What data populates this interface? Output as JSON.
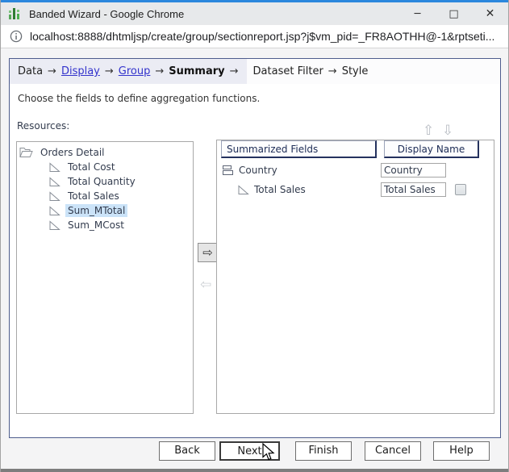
{
  "window": {
    "title": "Banded Wizard - Google Chrome",
    "icons": {
      "minimize": "─",
      "maximize": "□",
      "close": "✕"
    }
  },
  "address_bar": {
    "url": "localhost:8888/dhtmljsp/create/group/sectionreport.jsp?j$vm_pid=_FR8AOTHH@-1&rptseti..."
  },
  "breadcrumb": {
    "arrow": "→",
    "steps": [
      {
        "label": "Data",
        "type": "plain"
      },
      {
        "label": "Display",
        "type": "link"
      },
      {
        "label": "Group",
        "type": "link"
      },
      {
        "label": "Summary",
        "type": "current"
      },
      {
        "label": "Dataset Filter",
        "type": "future"
      },
      {
        "label": "Style",
        "type": "future"
      }
    ]
  },
  "instruction": "Choose the fields to define aggregation functions.",
  "resources_label": "Resources:",
  "tree": {
    "root": "Orders Detail",
    "items": [
      {
        "label": "Total Cost",
        "selected": false
      },
      {
        "label": "Total Quantity",
        "selected": false
      },
      {
        "label": "Total Sales",
        "selected": false
      },
      {
        "label": "Sum_MTotal",
        "selected": true
      },
      {
        "label": "Sum_MCost",
        "selected": false
      }
    ]
  },
  "summary_table": {
    "headers": [
      "Summarized Fields",
      "Display Name"
    ],
    "rows": [
      {
        "field": "Country",
        "display_name": "Country",
        "level": 0,
        "icon": "group-icon",
        "has_checkbox": false
      },
      {
        "field": "Total Sales",
        "display_name": "Total Sales",
        "level": 1,
        "icon": "field-icon",
        "has_checkbox": true
      }
    ]
  },
  "transfer": {
    "add_glyph": "⇨",
    "remove_glyph": "⇦"
  },
  "reorder": {
    "up_glyph": "⇧",
    "down_glyph": "⇩"
  },
  "buttons": {
    "back": "Back",
    "next": "Next",
    "finish": "Finish",
    "cancel": "Cancel",
    "help": "Help"
  },
  "colors": {
    "accent_strip": "#2b87dd",
    "titlebar_bg": "#e7e9eb",
    "crumbbar_bg": "#ebecf4",
    "wizard_border": "#4e5d8d",
    "link_blue": "#3333cc",
    "selection_bg": "#cbe3f8",
    "header_text": "#1c2b55"
  }
}
